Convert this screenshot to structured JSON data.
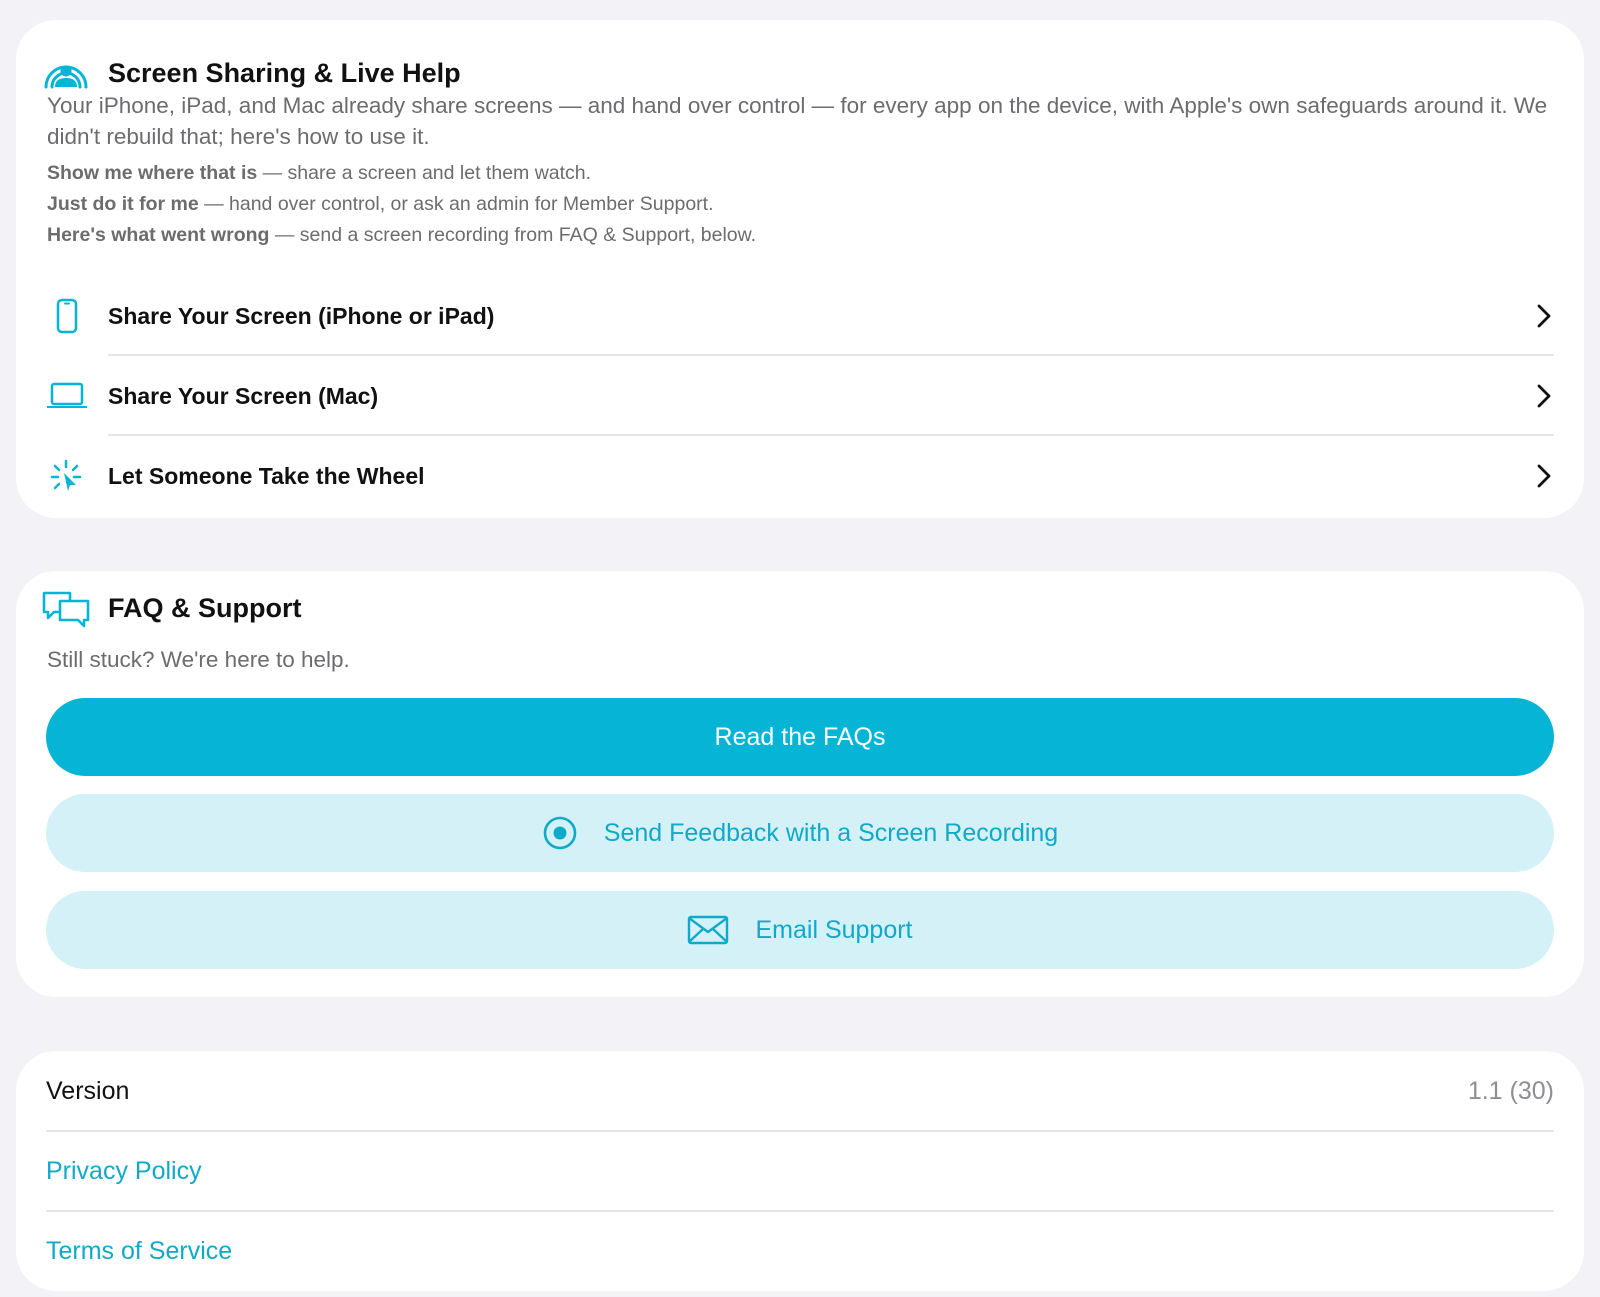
{
  "colors": {
    "accent": "#06b4d6",
    "accent_soft": "#d3f1f7",
    "link": "#10a9c9",
    "background": "#f2f2f7"
  },
  "screen_sharing": {
    "icon": "person-broadcast-icon",
    "title": "Screen Sharing & Live Help",
    "intro": "Your iPhone, iPad, and Mac already share screens — and hand over control — for every app on the device, with Apple's own safeguards around it. We didn't rebuild that; here's how to use it.",
    "hints": [
      {
        "lead": "Show me where that is",
        "text": " — share a screen and let them watch."
      },
      {
        "lead": "Just do it for me",
        "text": " — hand over control, or ask an admin for Member Support."
      },
      {
        "lead": "Here's what went wrong",
        "text": " — send a screen recording from FAQ & Support, below."
      }
    ],
    "rows": [
      {
        "label": "Share Your Screen (iPhone or iPad)",
        "icon": "iphone-icon"
      },
      {
        "label": "Share Your Screen (Mac)",
        "icon": "laptop-icon"
      },
      {
        "label": "Let Someone Take the Wheel",
        "icon": "cursor-click-icon"
      }
    ]
  },
  "faq": {
    "icon": "chat-bubbles-icon",
    "title": "FAQ & Support",
    "subtitle": "Still stuck? We're here to help.",
    "read_faqs_label": "Read the FAQs",
    "feedback_label": "Send Feedback with a Screen Recording",
    "feedback_icon": "record-icon",
    "email_label": "Email Support",
    "email_icon": "envelope-icon"
  },
  "about": {
    "version_label": "Version",
    "version_value": "1.1 (30)",
    "privacy_label": "Privacy Policy",
    "terms_label": "Terms of Service"
  }
}
